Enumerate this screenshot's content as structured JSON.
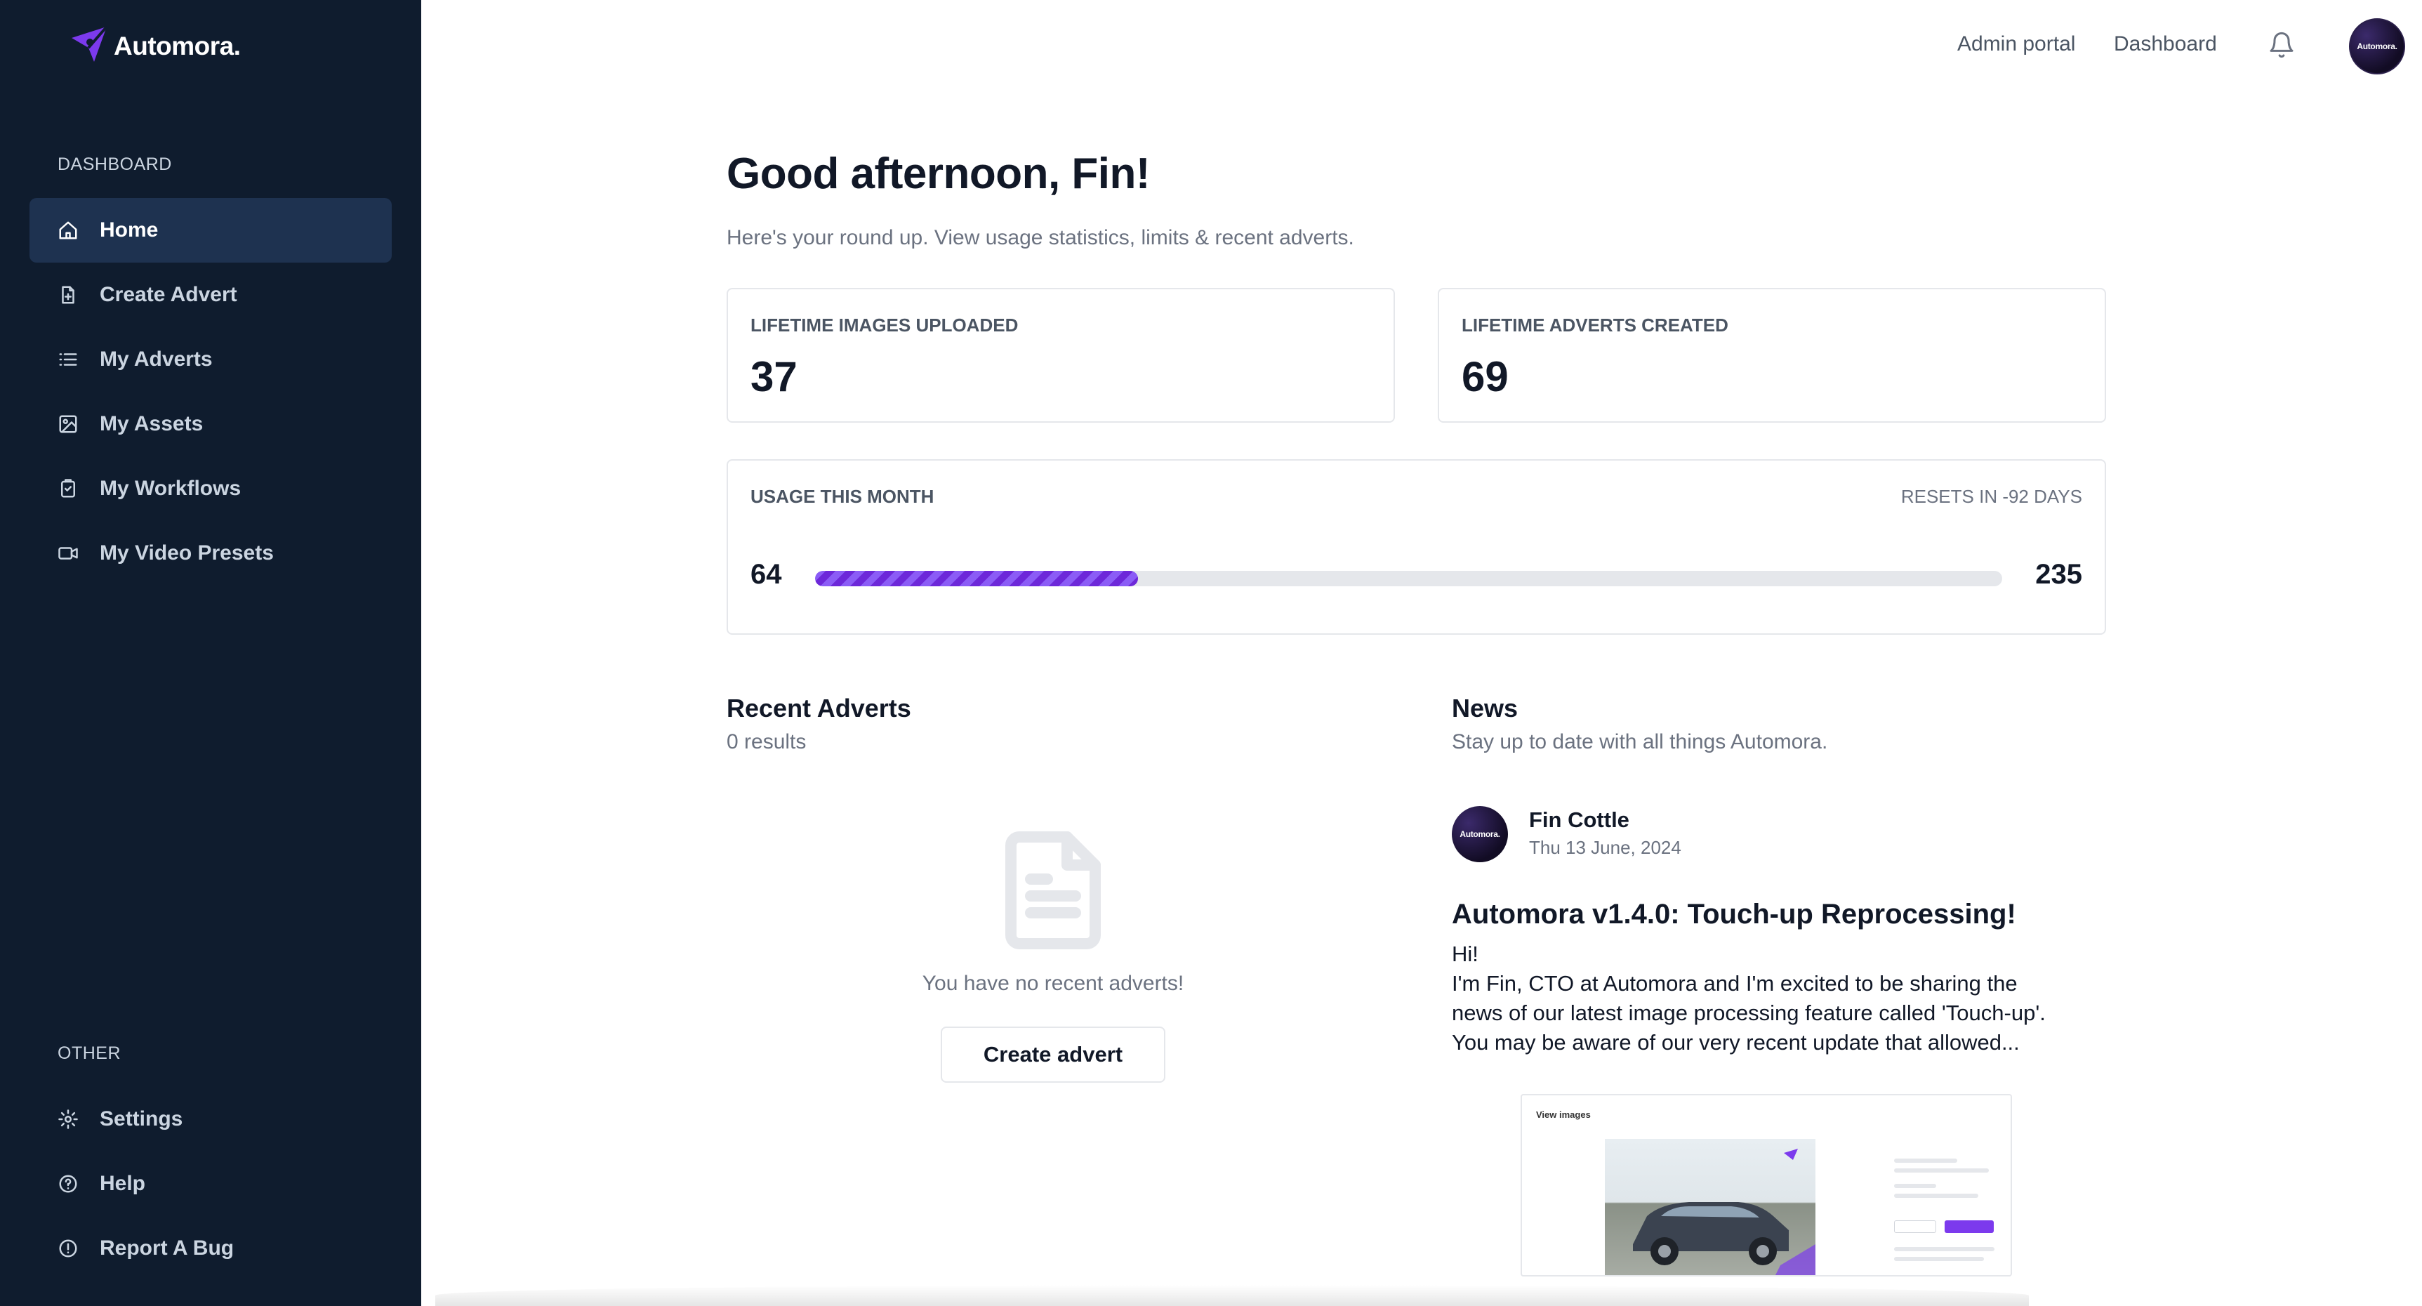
{
  "app": {
    "brand_name": "Automora.",
    "brand_color": "#7c3aed"
  },
  "sidebar": {
    "dashboard_label": "DASHBOARD",
    "items": [
      {
        "label": "Home",
        "icon": "home-icon",
        "active": true
      },
      {
        "label": "Create Advert",
        "icon": "file-plus-icon"
      },
      {
        "label": "My Adverts",
        "icon": "list-icon"
      },
      {
        "label": "My Assets",
        "icon": "image-icon"
      },
      {
        "label": "My Workflows",
        "icon": "clipboard-icon"
      },
      {
        "label": "My Video Presets",
        "icon": "video-icon"
      }
    ],
    "other_label": "OTHER",
    "other_items": [
      {
        "label": "Settings",
        "icon": "gear-icon"
      },
      {
        "label": "Help",
        "icon": "help-circle-icon"
      },
      {
        "label": "Report A Bug",
        "icon": "alert-circle-icon"
      }
    ]
  },
  "header": {
    "admin_portal": "Admin portal",
    "dashboard": "Dashboard",
    "bell_icon": "bell-icon",
    "avatar_text": "Automora."
  },
  "main": {
    "greeting": "Good afternoon, Fin!",
    "subtitle": "Here's your round up. View usage statistics, limits & recent adverts.",
    "stats": [
      {
        "label": "LIFETIME IMAGES UPLOADED",
        "value": "37"
      },
      {
        "label": "LIFETIME ADVERTS CREATED",
        "value": "69"
      }
    ],
    "usage": {
      "label": "USAGE THIS MONTH",
      "resets": "RESETS IN -92 DAYS",
      "used": "64",
      "limit": "235",
      "fraction": 0.272
    },
    "recent_adverts": {
      "title": "Recent Adverts",
      "count": "0 results",
      "empty_text": "You have no recent adverts!",
      "button_label": "Create advert"
    },
    "news": {
      "title": "News",
      "subtitle": "Stay up to date with all things Automora.",
      "author": "Fin Cottle",
      "date": "Thu 13 June, 2024",
      "headline": "Automora v1.4.0: Touch-up Reprocessing!",
      "body": [
        "Hi!",
        "I'm Fin, CTO at Automora and I'm excited to be sharing the",
        "news of our latest image processing feature called 'Touch-up'.",
        "You may be aware of our very recent update that allowed..."
      ],
      "image_title": "View images"
    }
  }
}
